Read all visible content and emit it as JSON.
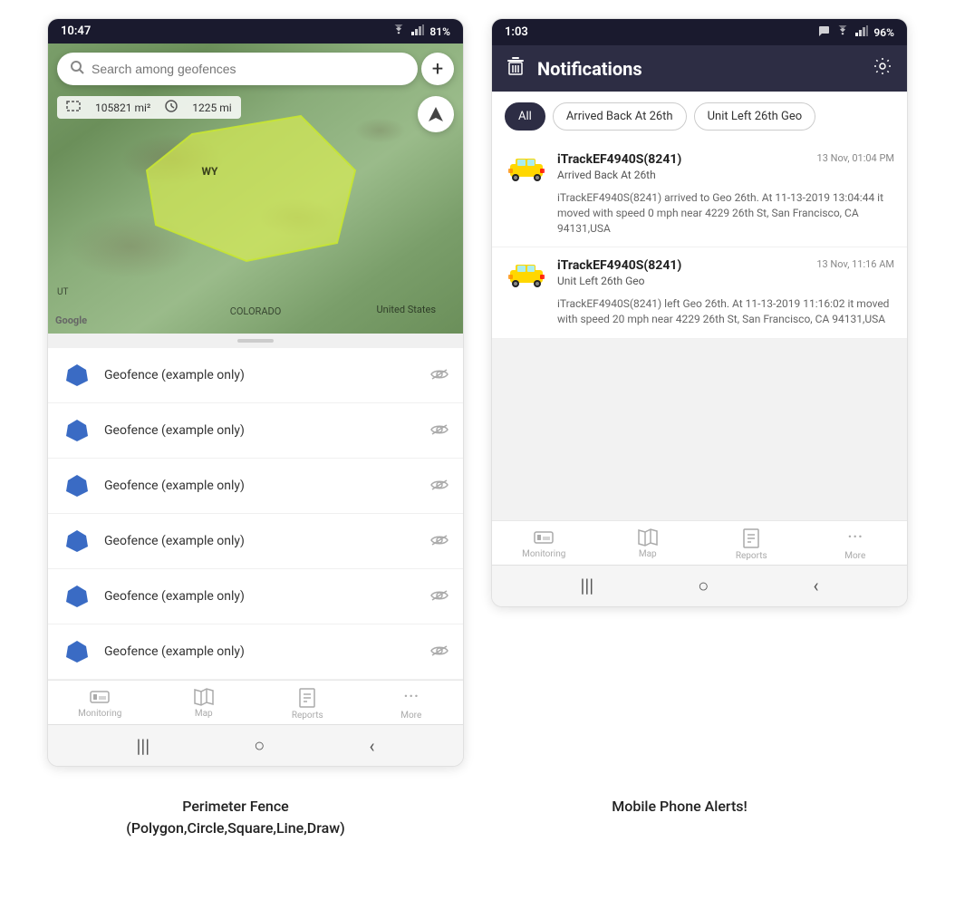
{
  "left_screen": {
    "status_bar": {
      "time": "10:47",
      "wifi_icon": "wifi",
      "signal_icon": "signal",
      "battery": "81%"
    },
    "search": {
      "placeholder": "Search among geofences"
    },
    "add_button_label": "+",
    "stats": {
      "area": "105821 mi²",
      "distance": "1225 mi"
    },
    "map_labels": {
      "state_wy": "WY",
      "country": "United States",
      "state_co": "COLORADO",
      "state_ut": "UT"
    },
    "google_label": "Google",
    "geofences": [
      {
        "name": "Geofence (example only)"
      },
      {
        "name": "Geofence (example only)"
      },
      {
        "name": "Geofence (example only)"
      },
      {
        "name": "Geofence (example only)"
      },
      {
        "name": "Geofence (example only)"
      },
      {
        "name": "Geofence (example only)"
      }
    ],
    "bottom_nav": [
      {
        "icon": "🚌",
        "label": "Monitoring"
      },
      {
        "icon": "🗺",
        "label": "Map"
      },
      {
        "icon": "📊",
        "label": "Reports"
      },
      {
        "icon": "⋯",
        "label": "More"
      }
    ]
  },
  "right_screen": {
    "status_bar": {
      "time": "1:03",
      "chat_icon": "chat",
      "wifi_icon": "wifi",
      "signal_icon": "signal",
      "battery": "96%"
    },
    "header": {
      "delete_icon": "trash",
      "title": "Notifications",
      "settings_icon": "gear"
    },
    "filter_tabs": [
      {
        "label": "All",
        "active": true
      },
      {
        "label": "Arrived Back At 26th",
        "active": false
      },
      {
        "label": "Unit Left 26th Geo",
        "active": false
      }
    ],
    "notifications": [
      {
        "device": "iTrackEF4940S(8241)",
        "timestamp": "13 Nov, 01:04 PM",
        "event": "Arrived Back At 26th",
        "detail": "iTrackEF4940S(8241) arrived to Geo 26th.    At 11-13-2019 13:04:44 it moved with speed 0 mph near 4229 26th St, San Francisco, CA 94131,USA"
      },
      {
        "device": "iTrackEF4940S(8241)",
        "timestamp": "13 Nov, 11:16 AM",
        "event": "Unit Left 26th Geo",
        "detail": "iTrackEF4940S(8241) left Geo 26th.    At 11-13-2019 11:16:02 it moved with speed 20 mph near 4229 26th St, San Francisco, CA 94131,USA"
      }
    ],
    "bottom_nav": [
      {
        "icon": "🚌",
        "label": "Monitoring"
      },
      {
        "icon": "🗺",
        "label": "Map"
      },
      {
        "icon": "📊",
        "label": "Reports"
      },
      {
        "icon": "⋯",
        "label": "More"
      }
    ]
  },
  "captions": {
    "left": "Perimeter Fence\n(Polygon,Circle,Square,Line,Draw)",
    "right": "Mobile Phone Alerts!"
  },
  "colors": {
    "header_dark": "#2d2d44",
    "geofence_blue": "#3a6bc4",
    "active_tab": "#2d2d44"
  }
}
